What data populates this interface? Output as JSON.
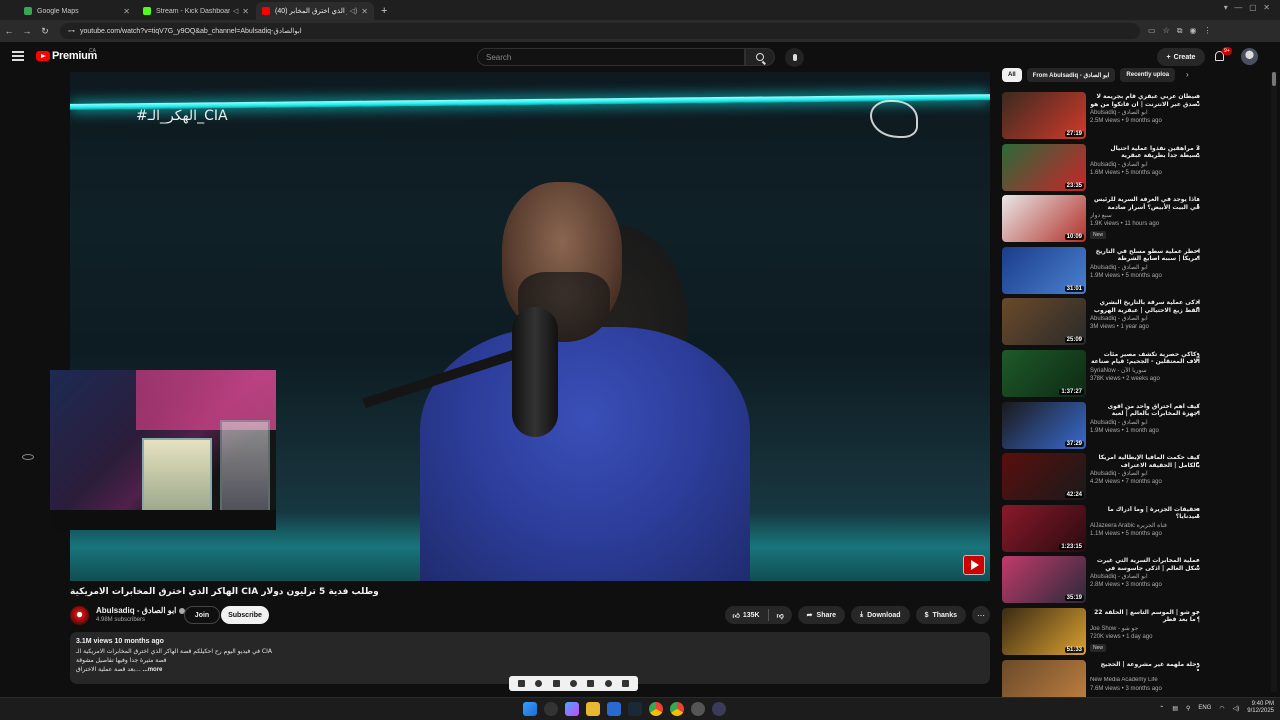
{
  "browser": {
    "tabs": [
      {
        "title": "Google Maps",
        "color": "#34a853",
        "active": false
      },
      {
        "title": "Stream - Kick Dashboard",
        "color": "#53fc18",
        "active": false
      },
      {
        "title": "(40) الهاكر الذي اخترق المخابر...",
        "color": "#ff0000",
        "active": true
      }
    ],
    "new_tab": "+",
    "url": "youtube.com/watch?v=tiqV7G_y9OQ&ab_channel=Abulsadiq-ابوالصادق"
  },
  "youtube": {
    "logo_text": "Premium",
    "country": "CA",
    "search_placeholder": "Search",
    "create_label": "Create",
    "notification_count": "9+"
  },
  "video": {
    "hashtag_overlay": "#الهكر_الـ_CIA",
    "title": "وطلب فدية 5 ترليون دولار CIA الهاكر الذي اخترق المخابرات الامريكية",
    "channel_name": "Abulsadiq - ابو الصادق",
    "subscribers": "4.98M subscribers",
    "join_label": "Join",
    "subscribe_label": "Subscribe",
    "likes": "135K",
    "share_label": "Share",
    "download_label": "Download",
    "thanks_label": "Thanks",
    "views_date": "3.1M views  10 months ago",
    "description_lines": [
      "في فيديو اليوم رح احكيلكم قصة الهاكر الذي اخترق المخابرات الامريكية الـ CIA",
      "قصة مثيرة جدا وفيها تفاصيل مشوقة",
      "بعد قصة عملية الاختراق..."
    ],
    "more_label": "...more"
  },
  "sidebar": {
    "chips": [
      "All",
      "From Abulsadiq - ابو الصادق",
      "Recently uploa"
    ],
    "recommendations": [
      {
        "title": "شيطان عربي عبقري قام بجريمة لا تصدق عبر الانترنت | ان فاتكوا من هو !",
        "channel": "Abulsadiq - ابو الصادق",
        "meta": "2.5M views • 9 months ago",
        "duration": "27:19",
        "c1": "#3b2a20",
        "c2": "#d13a2a",
        "new": ""
      },
      {
        "title": "3 مراهقين نفذوا عملية احتيال بسيطة جدا بطريقة عبقرية",
        "channel": "Abulsadiq - ابو الصادق",
        "meta": "1.6M views • 5 months ago",
        "duration": "23:35",
        "c1": "#2a6a3a",
        "c2": "#c9242a",
        "new": ""
      },
      {
        "title": "ماذا يوجد في الغرفة السرية للرئيس في البيت الأبيض؟ أسرار صادمة ستكشف لأول مرة",
        "channel": "سبع دوار",
        "meta": "1.9K views • 11 hours ago",
        "duration": "10:09",
        "c1": "#e8e8e8",
        "c2": "#b2302a",
        "new": "New"
      },
      {
        "title": "اخطر عملية سطو مسلح في التاريخ امريكا | سببه اصابع الشرطة",
        "channel": "Abulsadiq - ابو الصادق",
        "meta": "1.9M views • 5 months ago",
        "duration": "31:01",
        "c1": "#1a3d8a",
        "c2": "#4a80d0",
        "new": ""
      },
      {
        "title": "اذكى عملية سرقة بالتاريخ البشري القط زيع الاحتيالي | عبقرية الهروب",
        "channel": "Abulsadiq - ابو الصادق",
        "meta": "3M views • 1 year ago",
        "duration": "25:09",
        "c1": "#6a4a2a",
        "c2": "#2a2a2a",
        "new": ""
      },
      {
        "title": "ركاكي حصرية تكشف مصير مئات آلاف المعتقلين - الجحيم: قيام صناعة الموت",
        "channel": "SyriaNow - سوريا الآن",
        "meta": "378K views • 2 weeks ago",
        "duration": "1:37:27",
        "c1": "#1e5a2a",
        "c2": "#0e2a14",
        "new": ""
      },
      {
        "title": "كيف اهم اختراق واحد من اقوى اجهزة المخابرات بالعالم | لعبة الجنرالات !",
        "channel": "Abulsadiq - ابو الصادق",
        "meta": "1.9M views • 1 month ago",
        "duration": "37:29",
        "c1": "#1a1a1a",
        "c2": "#3a6ad0",
        "new": ""
      },
      {
        "title": "كيف حكمت المافيا الإيطالية امريكا بالكامل | الحقيقة الاعتراف",
        "channel": "Abulsadiq - ابو الصادق",
        "meta": "4.2M views • 7 months ago",
        "duration": "42:24",
        "c1": "#5a0e0e",
        "c2": "#1a1a1a",
        "new": ""
      },
      {
        "title": "تحقيقات الجزيرة | وما أدراك ما صيدنايا؟",
        "channel": "AlJazeera Arabic قناة الجزيرة",
        "meta": "1.1M views • 5 months ago",
        "duration": "1:23:15",
        "c1": "#8a1a2a",
        "c2": "#2a0a10",
        "new": ""
      },
      {
        "title": "عملية المخابرات السرية التي غيرت شكل العالم | اذكى جاسوسة في التاريخ",
        "channel": "Abulsadiq - ابو الصادق",
        "meta": "2.8M views • 3 months ago",
        "duration": "35:19",
        "c1": "#c23a6a",
        "c2": "#2a2a3a",
        "new": ""
      },
      {
        "title": "جو شو | الموسم التاسع | الحلقة 22 | ما بعد قطر",
        "channel": "Joe Show - جو شو",
        "meta": "720K views • 1 day ago",
        "duration": "51:33",
        "c1": "#3a2a14",
        "c2": "#d9a030",
        "new": "New"
      },
      {
        "title": "رحلة ملهمة غير مشروعة | الحجيج",
        "channel": "New Media Academy Life",
        "meta": "7.6M views • 3 months ago",
        "duration": "",
        "c1": "#6a4a2a",
        "c2": "#c08040",
        "new": ""
      }
    ]
  },
  "taskbar": {
    "lang": "ENG",
    "time": "9:40 PM",
    "date": "9/12/2025"
  }
}
